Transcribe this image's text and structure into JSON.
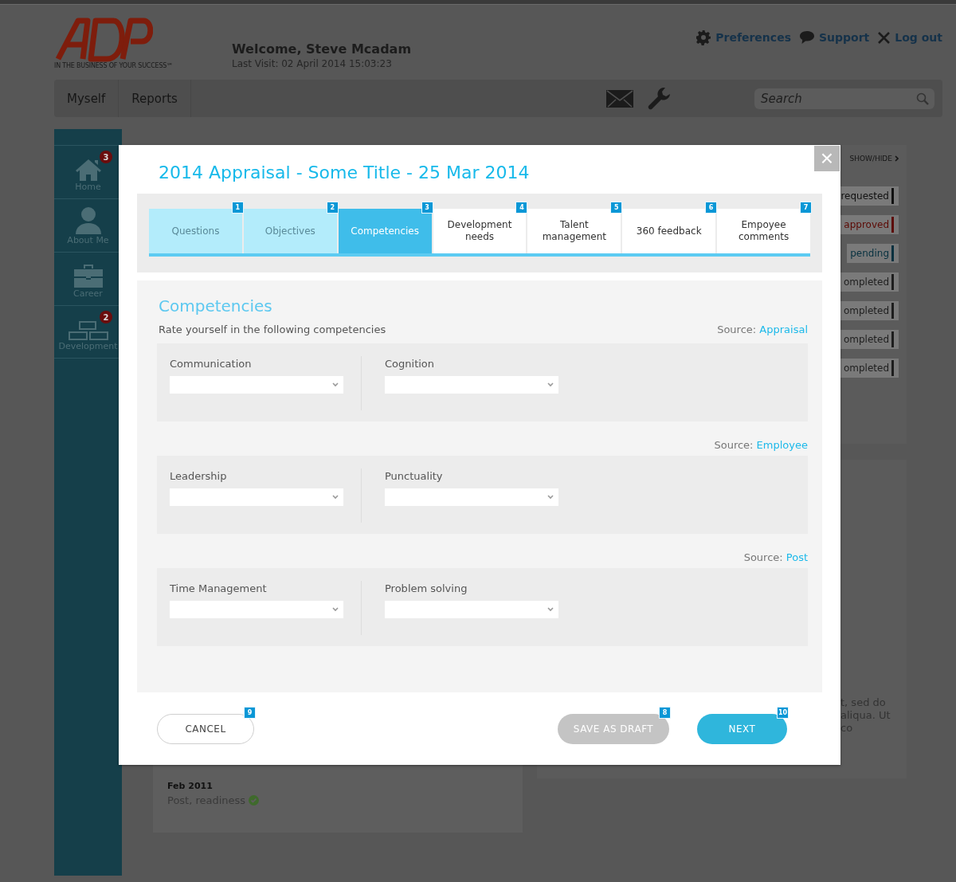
{
  "header": {
    "logo_tagline": "IN THE BUSINESS OF YOUR SUCCESS℠",
    "welcome": "Welcome,  Steve Mcadam",
    "last_visit": "Last Visit: 02 April 2014 15:03:23",
    "links": [
      {
        "kind": "gear",
        "label": "Preferences"
      },
      {
        "kind": "chat",
        "label": "Support"
      },
      {
        "kind": "close",
        "label": "Log out"
      }
    ]
  },
  "nav": {
    "items": [
      "Myself",
      "Reports"
    ],
    "search": {
      "placeholder": "Search"
    }
  },
  "sidebar": {
    "items": [
      {
        "kind": "home",
        "label": "Home",
        "badge": "3"
      },
      {
        "kind": "person",
        "label": "About Me"
      },
      {
        "kind": "briefcase",
        "label": "Career"
      },
      {
        "kind": "bricks",
        "label": "Development",
        "badge": "2"
      }
    ]
  },
  "history": {
    "date": "Feb 2011",
    "status": "Post, readiness"
  },
  "right_panel": {
    "toggle": "SHOW/HIDE",
    "statuses": [
      {
        "label": "requested",
        "color": "#111111"
      },
      {
        "label": "approved",
        "color": "#5c0a05"
      },
      {
        "label": "pending",
        "color": "#06303f"
      },
      {
        "label": "ompleted",
        "color": "#1e1e1e"
      },
      {
        "label": "ompleted",
        "color": "#1e1e1e"
      },
      {
        "label": "ompleted",
        "color": "#1e1e1e"
      },
      {
        "label": "ompleted",
        "color": "#1e1e1e"
      }
    ],
    "text_lines": [
      "t, sed do",
      "aliqua. Ut",
      "co"
    ]
  },
  "modal": {
    "title": "2014 Appraisal - Some Title - 25 Mar 2014",
    "close": "×",
    "tabs": [
      {
        "label": "Questions",
        "badge": "1",
        "done": true,
        "selected": false
      },
      {
        "label": "Objectives",
        "badge": "2",
        "done": true,
        "selected": false
      },
      {
        "label": "Competencies",
        "badge": "3",
        "done": true,
        "selected": true
      },
      {
        "label": "Development needs",
        "badge": "4",
        "done": false,
        "selected": false
      },
      {
        "label": "Talent management",
        "badge": "5",
        "done": false,
        "selected": false
      },
      {
        "label": "360 feedback",
        "badge": "6",
        "done": false,
        "selected": false
      },
      {
        "label": "Empoyee comments",
        "badge": "7",
        "done": false,
        "selected": false
      }
    ],
    "heading": "Competencies",
    "subtitle": "Rate yourself in the following competencies",
    "groups": [
      {
        "source_label": "Source:",
        "source": "Appraisal",
        "fields": [
          "Communication",
          "Cognition"
        ]
      },
      {
        "source_label": "Source:",
        "source": "Employee",
        "fields": [
          "Leadership",
          "Punctuality"
        ]
      },
      {
        "source_label": "Source:",
        "source": "Post",
        "fields": [
          "Time Management",
          "Problem solving"
        ]
      }
    ],
    "buttons": [
      {
        "kind": "cancel",
        "label": "CANCEL",
        "badge": "9"
      },
      {
        "kind": "draft",
        "label": "SAVE AS DRAFT",
        "badge": "8"
      },
      {
        "kind": "next",
        "label": "NEXT",
        "badge": "10"
      }
    ]
  }
}
